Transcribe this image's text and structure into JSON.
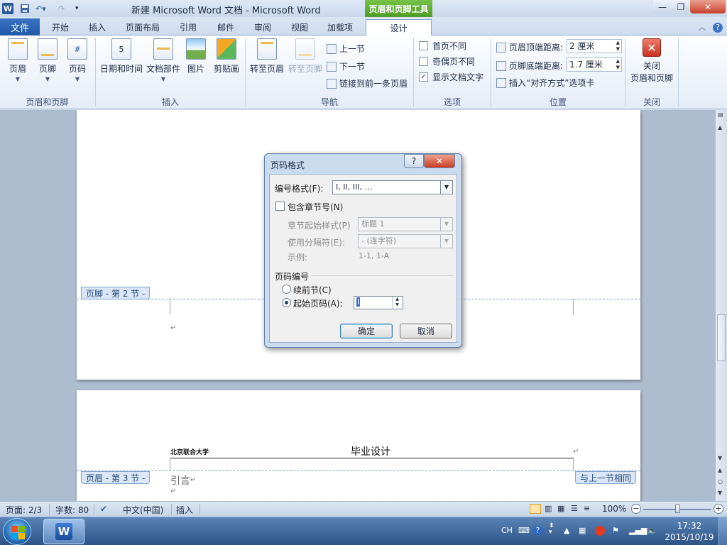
{
  "window": {
    "title": "新建 Microsoft Word 文档 - Microsoft Word",
    "context_tab_header": "页眉和页脚工具",
    "min": "—",
    "max": "❐",
    "close": "✕"
  },
  "tabs": {
    "file": "文件",
    "items": [
      "开始",
      "插入",
      "页面布局",
      "引用",
      "邮件",
      "审阅",
      "视图",
      "加载项",
      "设计"
    ]
  },
  "ribbon": {
    "groups": {
      "header_footer": "页眉和页脚",
      "insert": "插入",
      "navigation": "导航",
      "options": "选项",
      "position": "位置",
      "close": "关闭"
    },
    "buttons": {
      "header": "页眉",
      "footer": "页脚",
      "page_number": "页码",
      "date_time": "日期和时间",
      "doc_parts": "文档部件",
      "picture": "图片",
      "clip_art": "剪贴画",
      "goto_header": "转至页眉",
      "goto_footer": "转至页脚",
      "prev_section": "上一节",
      "next_section": "下一节",
      "link_previous": "链接到前一条页眉",
      "close_line1": "关闭",
      "close_line2": "页眉和页脚"
    },
    "options": {
      "diff_first": "首页不同",
      "diff_odd_even": "奇偶页不同",
      "show_doc_text": "显示文档文字"
    },
    "position": {
      "header_dist_label": "页眉顶端距离:",
      "header_dist_value": "2 厘米",
      "footer_dist_label": "页脚底端距离:",
      "footer_dist_value": "1.7 厘米",
      "insert_align_tab": "插入“对齐方式”选项卡"
    }
  },
  "document": {
    "footer_tag_sec2": "页脚 - 第 2 节 -",
    "header_tag_sec3": "页眉 - 第 3 节 -",
    "same_as_previous": "与上一节相同",
    "header_left_text": "北京联合大学",
    "header_center_text": "毕业设计",
    "body_text": "引言",
    "para_mark": "↵"
  },
  "dialog": {
    "title": "页码格式",
    "help": "?",
    "close": "✕",
    "number_format_label": "编号格式(F):",
    "number_format_value": "I, II, III, …",
    "include_chapter_label": "包含章节号(N)",
    "chapter_style_label": "章节起始样式(P)",
    "chapter_style_value": "标题 1",
    "separator_label": "使用分隔符(E):",
    "separator_value": "-  (连字符)",
    "example_label": "示例:",
    "example_value": "1-1, 1-A",
    "page_numbering_label": "页码编号",
    "continue_label": "续前节(C)",
    "start_at_label": "起始页码(A):",
    "start_at_value": "I",
    "ok": "确定",
    "cancel": "取消"
  },
  "statusbar": {
    "page": "页面: 2/3",
    "words": "字数: 80",
    "language": "中文(中国)",
    "mode": "插入",
    "zoom": "100%",
    "minus": "−",
    "plus": "+"
  },
  "taskbar": {
    "ime": "CH",
    "time": "17:32",
    "date": "2015/10/19"
  },
  "colors": {
    "file_tab": "#2b5fae",
    "context_tab": "#5aa62c",
    "close_button": "#c8402a"
  }
}
